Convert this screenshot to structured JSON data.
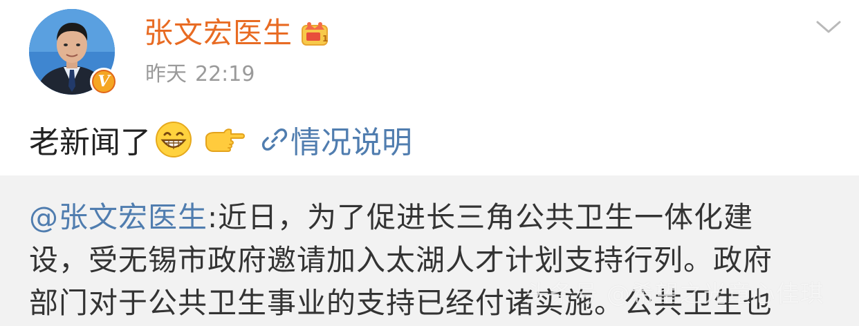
{
  "post": {
    "author": {
      "name": "张文宏医生",
      "verified_badge": "V",
      "crown_level": "1"
    },
    "timestamp": {
      "day": "昨天",
      "time": "22:19"
    },
    "text": "老新闻了",
    "link_label": "情况说明",
    "emojis": [
      "grin-emoji",
      "pointing-hand-emoji"
    ]
  },
  "quoted": {
    "mention": "@张文宏医生",
    "lines": [
      ":近日，为了促进长三角公共卫生一体化建",
      "设，受无锡市政府邀请加入太湖人才计划支持行列。政府",
      "部门对于公共卫生事业的支持已经付诸实施。公共卫生也"
    ]
  },
  "watermark": "头条号 @希望之光童心佳琪",
  "colors": {
    "username": "#e86b23",
    "link": "#507daf",
    "timestamp": "#9a9a9a",
    "quote_bg": "#f2f2f2",
    "badge": "#f5a623"
  }
}
